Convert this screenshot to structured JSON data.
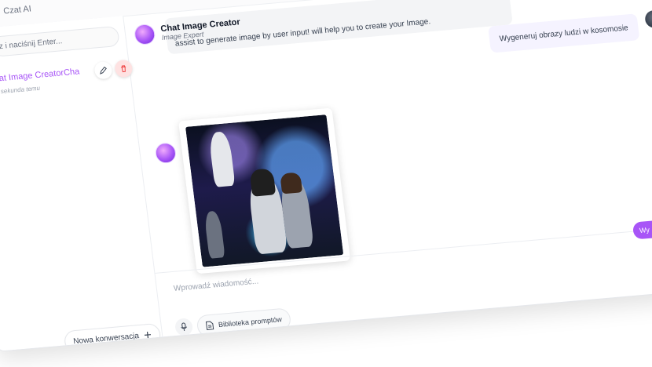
{
  "topbar": {
    "title": "Czat AI"
  },
  "sidebar": {
    "search_placeholder": "z i naciśnij Enter...",
    "conversation": {
      "title": "at Image CreatorCha",
      "time": "sekunda temu"
    },
    "new_conversation_label": "Nowa konwersacja"
  },
  "chat": {
    "bot_name": "Chat Image Creator",
    "bot_role": "Image Expert",
    "bot_intro": "assist to generate image by user input! will help you to create your Image.",
    "user_message": "Wygeneruj obrazy ludzi w kosomosie",
    "input_placeholder": "Wprowadź wiadomość...",
    "send_label": "Wy",
    "prompt_library_label": "Biblioteka promptów"
  },
  "colors": {
    "accent": "#a855f7",
    "delete_bg": "#fee2e2"
  },
  "icons": [
    "pencil-icon",
    "trash-icon",
    "plus-icon",
    "microphone-icon",
    "document-icon"
  ]
}
